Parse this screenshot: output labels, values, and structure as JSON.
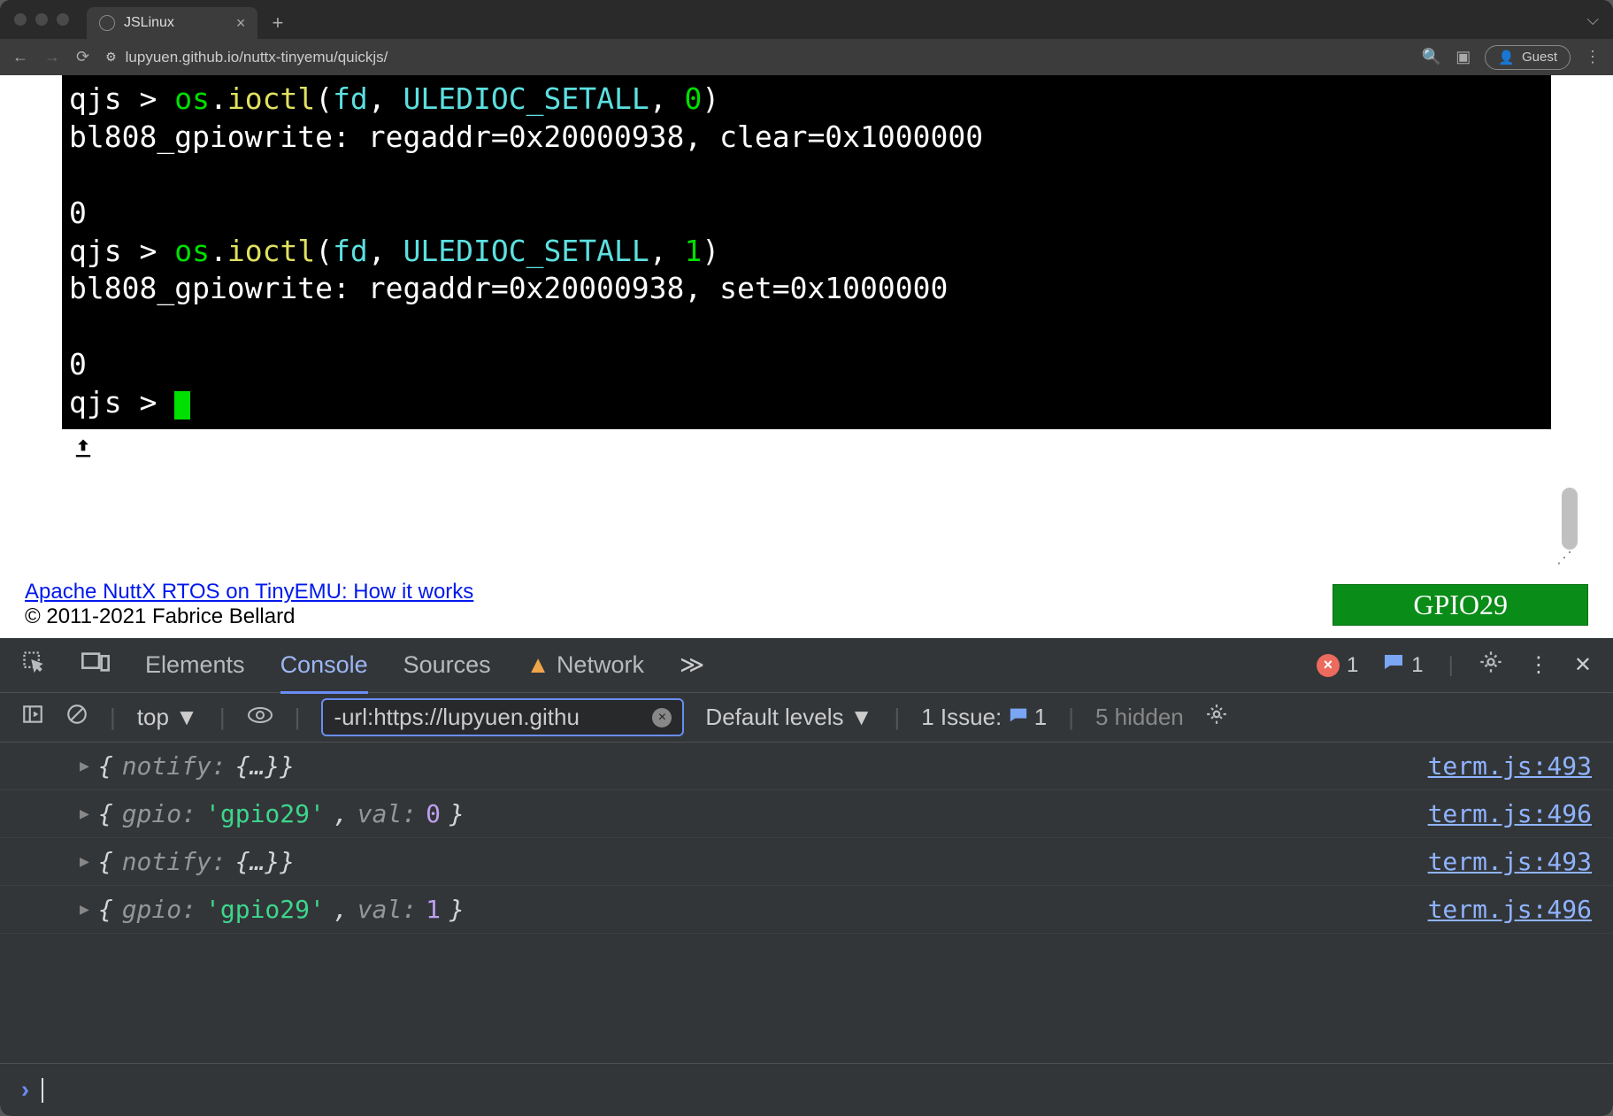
{
  "browser": {
    "tab_title": "JSLinux",
    "url": "lupyuen.github.io/nuttx-tinyemu/quickjs/",
    "guest_label": "Guest"
  },
  "terminal": {
    "lines": [
      {
        "type": "cmd",
        "prompt": "qjs > ",
        "parts": [
          {
            "t": "os",
            "c": "green"
          },
          {
            "t": ".",
            "c": "white"
          },
          {
            "t": "ioctl",
            "c": "yellow"
          },
          {
            "t": "(",
            "c": "white"
          },
          {
            "t": "fd",
            "c": "cyan"
          },
          {
            "t": ", ",
            "c": "white"
          },
          {
            "t": "ULEDIOC_SETALL",
            "c": "cyan"
          },
          {
            "t": ", ",
            "c": "white"
          },
          {
            "t": "0",
            "c": "green"
          },
          {
            "t": ")",
            "c": "white"
          }
        ]
      },
      {
        "type": "out",
        "text": "bl808_gpiowrite: regaddr=0x20000938, clear=0x1000000"
      },
      {
        "type": "blank"
      },
      {
        "type": "out",
        "text": "0"
      },
      {
        "type": "cmd",
        "prompt": "qjs > ",
        "parts": [
          {
            "t": "os",
            "c": "green"
          },
          {
            "t": ".",
            "c": "white"
          },
          {
            "t": "ioctl",
            "c": "yellow"
          },
          {
            "t": "(",
            "c": "white"
          },
          {
            "t": "fd",
            "c": "cyan"
          },
          {
            "t": ", ",
            "c": "white"
          },
          {
            "t": "ULEDIOC_SETALL",
            "c": "cyan"
          },
          {
            "t": ", ",
            "c": "white"
          },
          {
            "t": "1",
            "c": "green"
          },
          {
            "t": ")",
            "c": "white"
          }
        ]
      },
      {
        "type": "out",
        "text": "bl808_gpiowrite: regaddr=0x20000938, set=0x1000000"
      },
      {
        "type": "blank"
      },
      {
        "type": "out",
        "text": "0"
      },
      {
        "type": "prompt",
        "prompt": "qjs > "
      }
    ]
  },
  "footer": {
    "link_text": "Apache NuttX RTOS on TinyEMU: How it works",
    "copyright": "© 2011-2021 Fabrice Bellard",
    "gpio_label": "GPIO29"
  },
  "devtools": {
    "tabs": [
      "Elements",
      "Console",
      "Sources",
      "Network"
    ],
    "active_tab": "Console",
    "error_count": "1",
    "info_count": "1",
    "context": "top",
    "filter_value": "-url:https://lupyuen.githu",
    "levels_label": "Default levels",
    "issues_label": "1 Issue:",
    "issues_count": "1",
    "hidden_label": "5 hidden",
    "logs": [
      {
        "obj": "{notify: {…}}",
        "key": "notify",
        "val_raw": "{…}",
        "val_type": "obj",
        "src": "term.js:493"
      },
      {
        "obj": "{gpio: 'gpio29', val: 0}",
        "key": "gpio",
        "val_str": "'gpio29'",
        "key2": "val",
        "val2": "0",
        "src": "term.js:496"
      },
      {
        "obj": "{notify: {…}}",
        "key": "notify",
        "val_raw": "{…}",
        "val_type": "obj",
        "src": "term.js:493"
      },
      {
        "obj": "{gpio: 'gpio29', val: 1}",
        "key": "gpio",
        "val_str": "'gpio29'",
        "key2": "val",
        "val2": "1",
        "src": "term.js:496"
      }
    ]
  }
}
